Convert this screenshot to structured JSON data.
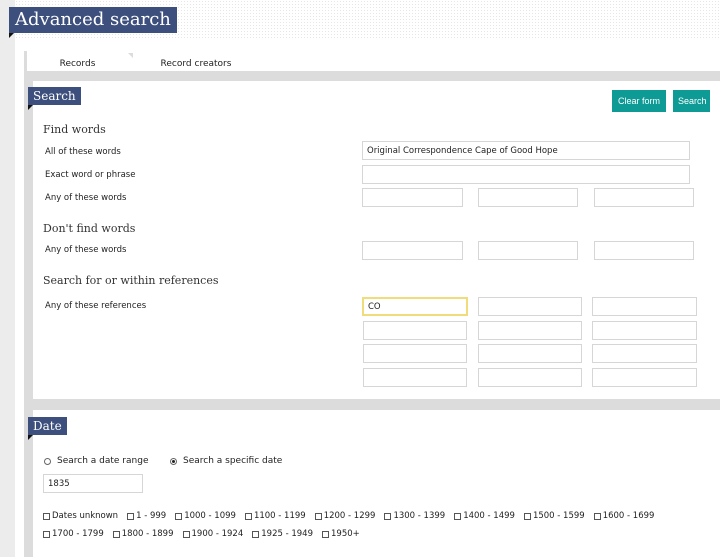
{
  "page": {
    "title": "Advanced search"
  },
  "tabs": [
    {
      "label": "Records",
      "active": true
    },
    {
      "label": "Record creators",
      "active": false
    }
  ],
  "search": {
    "section_title": "Search",
    "buttons": {
      "clear": "Clear form",
      "search": "Search"
    },
    "find_words": {
      "heading": "Find words",
      "all_label": "All of these words",
      "all_value": "Original Correspondence Cape of Good Hope",
      "exact_label": "Exact word or phrase",
      "exact_value": "",
      "any_label": "Any of these words",
      "any_values": [
        "",
        "",
        ""
      ]
    },
    "dont_find": {
      "heading": "Don't find words",
      "any_label": "Any of these words",
      "any_values": [
        "",
        "",
        ""
      ]
    },
    "references": {
      "heading": "Search for or within references",
      "label": "Any of these references",
      "values": [
        "CO",
        "",
        "",
        "",
        "",
        "",
        "",
        "",
        "",
        "",
        "",
        ""
      ]
    }
  },
  "date": {
    "section_title": "Date",
    "radios": [
      {
        "label": "Search a date range",
        "checked": false
      },
      {
        "label": "Search a specific date",
        "checked": true
      }
    ],
    "specific_value": "1835",
    "ranges_row1": [
      "Dates unknown",
      "1 - 999",
      "1000 - 1099",
      "1100 - 1199",
      "1200 - 1299",
      "1300 - 1399",
      "1400 - 1499",
      "1500 - 1599",
      "1600 - 1699"
    ],
    "ranges_row2": [
      "1700 - 1799",
      "1800 - 1899",
      "1900 - 1924",
      "1925 - 1949",
      "1950+"
    ]
  },
  "colors": {
    "accent": "#0e9a95",
    "ribbon": "#3d4f7c",
    "focus": "#f0dc7a"
  }
}
